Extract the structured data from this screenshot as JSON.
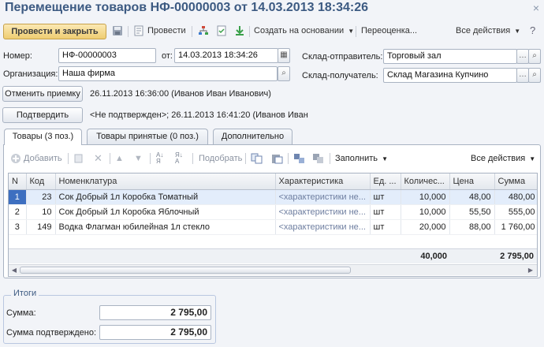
{
  "window": {
    "title": "Перемещение товаров НФ-00000003 от 14.03.2013 18:34:26",
    "close_glyph": "×"
  },
  "toolbar": {
    "post_and_close": "Провести и закрыть",
    "post": "Провести",
    "create_based_on": "Создать на основании",
    "reprice": "Переоценка...",
    "all_actions": "Все действия",
    "icons": [
      "save-icon",
      "post-icon",
      "structure-icon",
      "report-icon",
      "download-icon"
    ]
  },
  "header": {
    "number_label": "Номер:",
    "number_value": "НФ-00000003",
    "from_label": "от:",
    "date_value": "14.03.2013 18:34:26",
    "org_label": "Организация:",
    "org_value": "Наша фирма",
    "sender_label": "Склад-отправитель:",
    "sender_value": "Торговый зал",
    "receiver_label": "Склад-получатель:",
    "receiver_value": "Склад Магазина Купчино"
  },
  "actions": {
    "cancel_receipt": "Отменить приемку",
    "cancel_receipt_info": "26.11.2013 16:36:00 (Иванов Иван Иванович)",
    "confirm": "Подтвердить",
    "confirm_info": "<Не подтвержден>; 26.11.2013 16:41:20 (Иванов Иван"
  },
  "tabs": [
    {
      "label": "Товары (3 поз.)",
      "active": true
    },
    {
      "label": "Товары принятые (0 поз.)",
      "active": false
    },
    {
      "label": "Дополнительно",
      "active": false
    }
  ],
  "table_toolbar": {
    "add": "Добавить",
    "pick": "Подобрать",
    "fill": "Заполнить",
    "all_actions": "Все действия"
  },
  "table": {
    "columns": [
      "N",
      "Код",
      "Номенклатура",
      "Характеристика",
      "Ед. ...",
      "Количес...",
      "Цена",
      "Сумма"
    ],
    "rows": [
      [
        "1",
        "23",
        "Сок Добрый 1л Коробка Томатный",
        "<характеристики не...",
        "шт",
        "10,000",
        "48,00",
        "480,00"
      ],
      [
        "2",
        "10",
        "Сок Добрый 1л Коробка Яблочный",
        "<характеристики не...",
        "шт",
        "10,000",
        "55,50",
        "555,00"
      ],
      [
        "3",
        "149",
        "Водка Флагман юбилейная 1л стекло",
        "<характеристики не...",
        "шт",
        "20,000",
        "88,00",
        "1 760,00"
      ]
    ],
    "selected_row": 0,
    "total_quantity": "40,000",
    "total_sum": "2 795,00"
  },
  "totals": {
    "group_title": "Итоги",
    "sum_label": "Сумма:",
    "sum_value": "2 795,00",
    "confirmed_label": "Сумма подтверждено:",
    "confirmed_value": "2 795,00"
  },
  "colors": {
    "title": "#3c5a82",
    "primary_button": "#efcd72",
    "selected_row": "#e3edfb",
    "selected_marker": "#3d6fc0"
  }
}
